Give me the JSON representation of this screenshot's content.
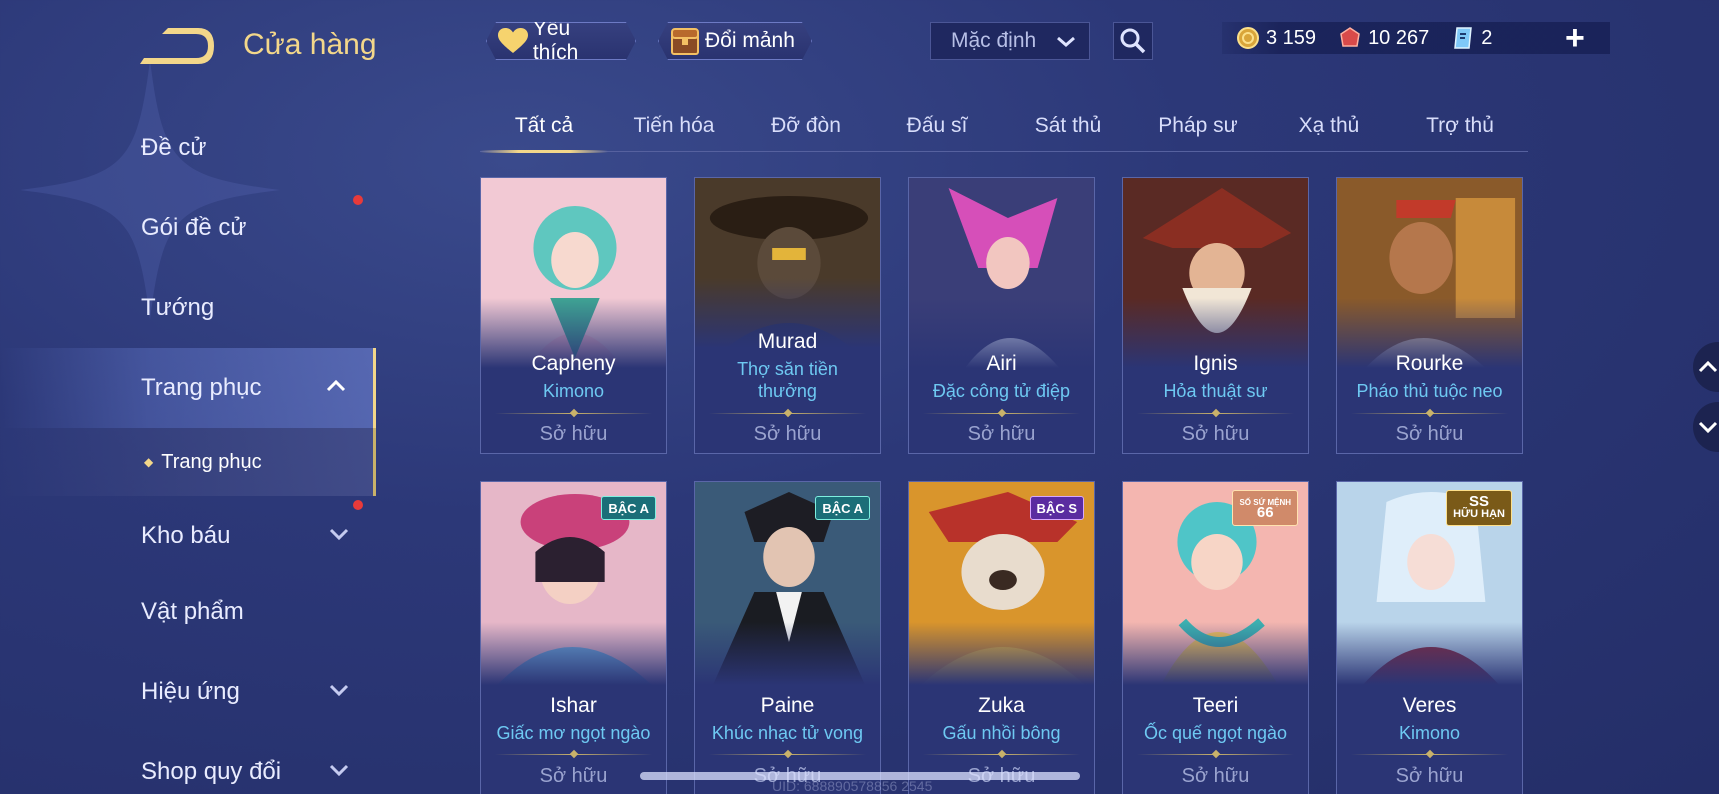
{
  "header": {
    "title": "Cửa hàng",
    "favorite_label": "Yêu thích",
    "exchange_label": "Đổi mảnh",
    "sort_value": "Mặc định",
    "currency": {
      "gold": "3 159",
      "quan_huy": "10 267",
      "coupons": "2"
    }
  },
  "sidebar": {
    "items": [
      {
        "label": "Đề cử"
      },
      {
        "label": "Gói đề cử"
      },
      {
        "label": "Tướng"
      },
      {
        "label": "Trang phục"
      },
      {
        "label": "Kho báu"
      },
      {
        "label": "Vật phẩm"
      },
      {
        "label": "Hiệu ứng"
      },
      {
        "label": "Shop quy đổi"
      }
    ],
    "sub_item": "Trang phục"
  },
  "tabs": [
    "Tất cả",
    "Tiến hóa",
    "Đỡ đòn",
    "Đấu sĩ",
    "Sát thủ",
    "Pháp sư",
    "Xạ thủ",
    "Trợ thủ"
  ],
  "cards": [
    {
      "hero": "Capheny",
      "skin": "Kimono",
      "status": "Sở hữu"
    },
    {
      "hero": "Murad",
      "skin": "Thợ săn tiền thưởng",
      "status": "Sở hữu"
    },
    {
      "hero": "Airi",
      "skin": "Đặc công tử điệp",
      "status": "Sở hữu"
    },
    {
      "hero": "Ignis",
      "skin": "Hỏa thuật sư",
      "status": "Sở hữu"
    },
    {
      "hero": "Rourke",
      "skin": "Pháo thủ tuộc neo",
      "status": "Sở hữu"
    },
    {
      "hero": "Ishar",
      "skin": "Giấc mơ ngọt ngào",
      "status": "Sở hữu",
      "badge": "BẬC A"
    },
    {
      "hero": "Paine",
      "skin": "Khúc nhạc tử vong",
      "status": "Sở hữu",
      "badge": "BẬC A"
    },
    {
      "hero": "Zuka",
      "skin": "Gấu nhồi bông",
      "status": "Sở hữu",
      "badge": "BẬC S"
    },
    {
      "hero": "Teeri",
      "skin": "Ốc quế ngọt ngào",
      "status": "Sở hữu",
      "badge_small": "SỐ SỨ MỆNH",
      "badge_big": "66"
    },
    {
      "hero": "Veres",
      "skin": "Kimono",
      "status": "Sở hữu",
      "badge_big": "SS",
      "badge_small": "HỮU HẠN"
    }
  ],
  "footer": {
    "uid": "UID: 688890578856 2545"
  },
  "colors": {
    "accent_gold": "#f3d78a",
    "skin_name_blue": "#6ec9f2",
    "notification_red": "#e83a3a"
  }
}
